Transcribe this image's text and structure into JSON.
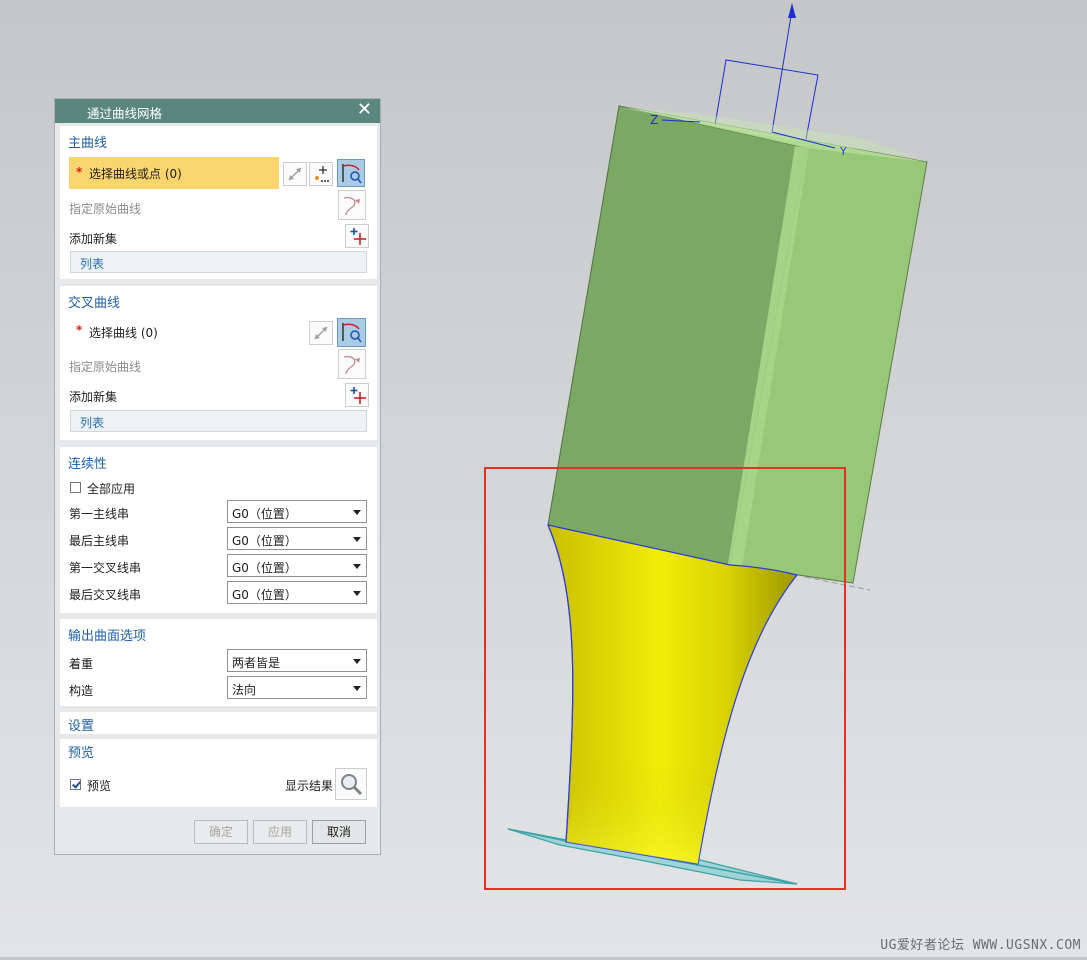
{
  "dialog": {
    "title": "通过曲线网格",
    "close_glyph": "✕",
    "primary_curves": {
      "title": "主曲线",
      "select_label": "选择曲线或点 (0)",
      "required_mark": "*",
      "specify_origin": "指定原始曲线",
      "add_new_set": "添加新集",
      "list_label": "列表"
    },
    "cross_curves": {
      "title": "交叉曲线",
      "select_label": "选择曲线 (0)",
      "required_mark": "*",
      "specify_origin": "指定原始曲线",
      "add_new_set": "添加新集",
      "list_label": "列表"
    },
    "continuity": {
      "title": "连续性",
      "apply_all_label": "全部应用",
      "apply_all_checked": false,
      "rows": [
        {
          "label": "第一主线串",
          "value": "G0（位置）"
        },
        {
          "label": "最后主线串",
          "value": "G0（位置）"
        },
        {
          "label": "第一交叉线串",
          "value": "G0（位置）"
        },
        {
          "label": "最后交叉线串",
          "value": "G0（位置）"
        }
      ]
    },
    "output_options": {
      "title": "输出曲面选项",
      "rows": [
        {
          "label": "着重",
          "value": "两者皆是"
        },
        {
          "label": "构造",
          "value": "法向"
        }
      ]
    },
    "settings": {
      "title": "设置"
    },
    "preview": {
      "title": "预览",
      "checkbox_label": "预览",
      "checked": true,
      "show_result_label": "显示结果"
    },
    "buttons": {
      "ok": "确定",
      "apply": "应用",
      "cancel": "取消"
    }
  },
  "viewport": {
    "axis_labels": {
      "z": "Z",
      "y": "Y"
    },
    "colors": {
      "box_front": "#7ca865",
      "box_side": "#96c878",
      "surface": "#e6e10a",
      "highlight_frame": "#e53125",
      "csys_blue": "#1a2fd6",
      "plane_cyan": "#3aa3a8"
    }
  },
  "watermark": "UG爱好者论坛 WWW.UGSNX.COM"
}
